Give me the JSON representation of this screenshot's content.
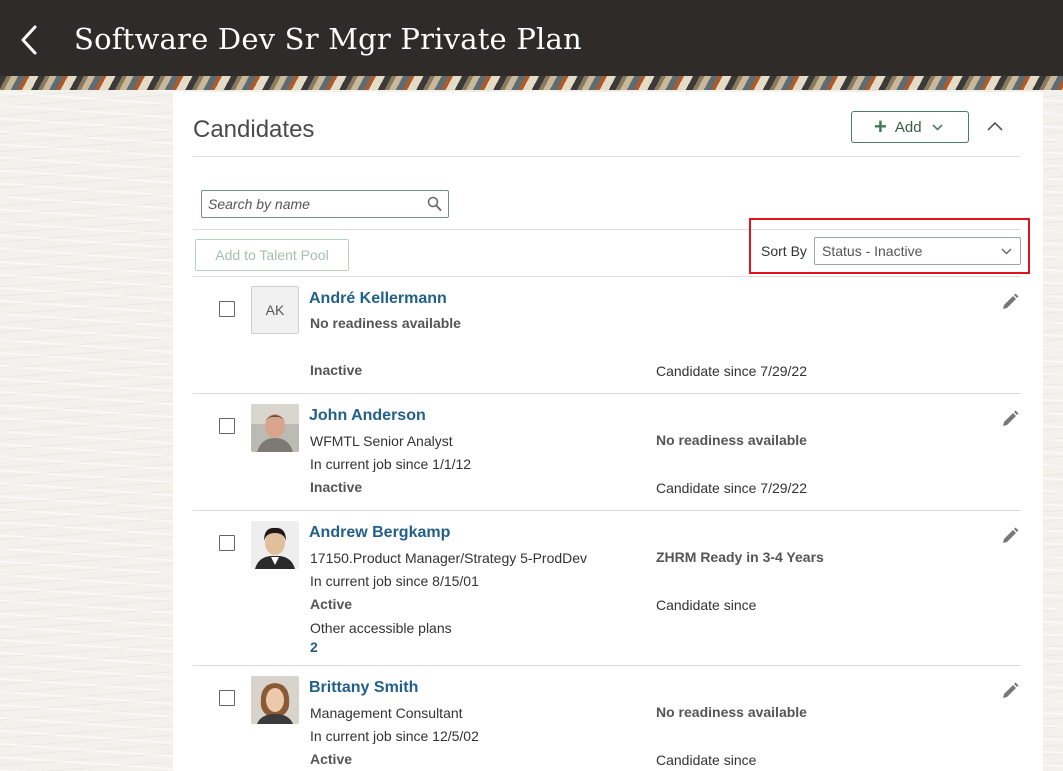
{
  "header": {
    "title": "Software Dev Sr Mgr Private Plan"
  },
  "section": {
    "title": "Candidates",
    "add_label": "Add"
  },
  "search": {
    "placeholder": "Search by name"
  },
  "toolbar": {
    "talent_pool_label": "Add to Talent Pool",
    "sort_label": "Sort By",
    "sort_value": "Status - Inactive"
  },
  "candidates": [
    {
      "name": "André Kellermann",
      "initials": "AK",
      "readiness": "No readiness available",
      "status": "Inactive",
      "candidate_since": "Candidate since 7/29/22"
    },
    {
      "name": "John Anderson",
      "job": "WFMTL Senior Analyst",
      "job_since": "In current job since 1/1/12",
      "readiness": "No readiness available",
      "status": "Inactive",
      "candidate_since": "Candidate since 7/29/22"
    },
    {
      "name": "Andrew Bergkamp",
      "job": "17150.Product Manager/Strategy 5-ProdDev",
      "job_since": "In current job since 8/15/01",
      "readiness": "ZHRM Ready in 3-4 Years",
      "status": "Active",
      "candidate_since": "Candidate since",
      "other_plans_label": "Other accessible plans",
      "other_plans_count": "2"
    },
    {
      "name": "Brittany Smith",
      "job": "Management Consultant",
      "job_since": "In current job since 12/5/02",
      "readiness": "No readiness available",
      "status": "Active",
      "candidate_since": "Candidate since"
    }
  ],
  "colors": {
    "header_bg": "#2f2b28",
    "link": "#22608a",
    "highlight": "#e0161c",
    "accent_green": "#3f7a53"
  }
}
